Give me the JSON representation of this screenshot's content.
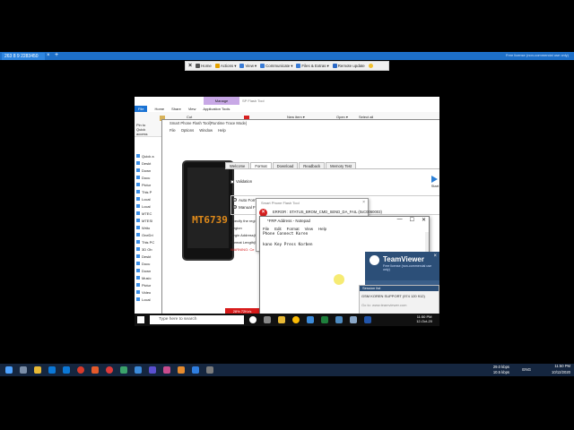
{
  "tv_tab": {
    "label": "263 8 9 2283450",
    "close": "×",
    "add": "+"
  },
  "tv_license": "Free license (non-commercial use only)",
  "remote_toolbar": {
    "close": "×",
    "home": "Home",
    "actions": "Actions",
    "view": "View",
    "communicate": "Communicate",
    "files": "Files & Extras",
    "remote_update": "Remote update"
  },
  "explorer": {
    "manage_tab": "Manage",
    "bg_title": "SP Flash Tool",
    "tabs": [
      "File",
      "Home",
      "Share",
      "View",
      "Application Tools"
    ],
    "ribbon_cut": "Cut",
    "ribbon_new_item": "New item ▾",
    "ribbon_open": "Open ▾",
    "ribbon_select_all": "Select all",
    "ribbon_pin": "Pin to Quick access",
    "nav_items": [
      "Quick a",
      "Deskt",
      "Down",
      "Docu",
      "Pictur",
      "This P",
      "Local",
      "Local",
      "MTEC",
      "MTESI",
      "Writo",
      "OneDri",
      "This PC",
      "3D Ob",
      "Deskt",
      "Docu",
      "Down",
      "Music",
      "Pictur",
      "Video",
      "Local"
    ]
  },
  "spft": {
    "title": "Smart Phone Flash Tool(Runtime Trace Mode)",
    "menu": [
      "File",
      "Options",
      "Window",
      "Help"
    ],
    "chip": "MT6739",
    "tabs": [
      "Welcome",
      "Format",
      "Download",
      "Readback",
      "Memory Test"
    ],
    "validation": "Validation",
    "start": "Start",
    "auto_format": "Auto Format Flash",
    "manual_format": "Manual Format Flash",
    "spec_label": "Specify the regi",
    "region": "Region",
    "begin_address": "Begin Address(H",
    "format_length": "Format Length(H",
    "warning": "WARNING: Ce",
    "progress": "28% 72Kr/s",
    "progress_value": 0.28
  },
  "error_dialog": {
    "title": "Smart Phone Flash Tool",
    "icon": "×",
    "message": "ERROR : STATUS_BROM_CMD_SEND_DA_FAIL (0xC0060003)"
  },
  "notepad": {
    "title": "*FRP Address - Notepad",
    "menu": [
      "File",
      "Edit",
      "Format",
      "View",
      "Help"
    ],
    "text": "Phone Connect Koren\n\nkano Key Press Korben",
    "minimize": "—",
    "maximize": "☐",
    "close": "✕"
  },
  "teamviewer_popup": {
    "logo": "TeamViewer",
    "sub": "Free license (non-commercial use only)",
    "session_title": "Session list",
    "session_item": "GSM KOREN SUPPORT (974 120 912)",
    "footer": "Go to: www.teamviewer.com"
  },
  "remote_taskbar": {
    "search_placeholder": "Type here to search",
    "time": "11:50 PM",
    "date": "12-Oct-20"
  },
  "local_taskbar": {
    "net_up": "29.0 kbps",
    "net_down": "10.5 kbps",
    "lang": "ENG",
    "time": "11:50 PM",
    "date": "10/12/2020"
  },
  "colors": {
    "tv_blue": "#1d6fc8",
    "error_red": "#d72020",
    "chip_orange": "#e08a1a",
    "manage_purple": "#c8a8e6"
  }
}
